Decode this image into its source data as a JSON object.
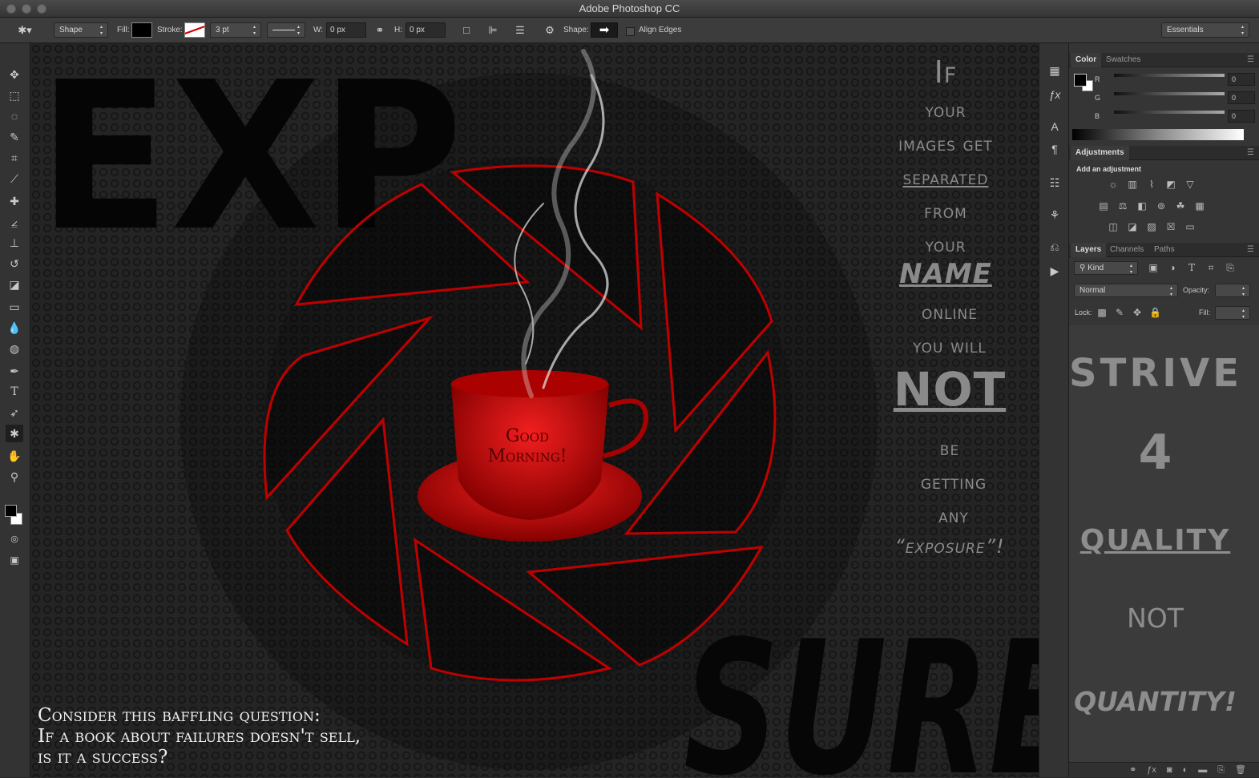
{
  "app": {
    "title": "Adobe Photoshop CC"
  },
  "options_bar": {
    "tool_mode": "Shape",
    "fill_label": "Fill:",
    "stroke_label": "Stroke:",
    "stroke_width": "3 pt",
    "w_label": "W:",
    "w_value": "0 px",
    "h_label": "H:",
    "h_value": "0 px",
    "shape_label": "Shape:",
    "align_edges": "Align Edges",
    "workspace": "Essentials"
  },
  "tools": [
    "move-tool",
    "marquee-tool",
    "lasso-tool",
    "quick-select-tool",
    "crop-tool",
    "eyedropper-tool",
    "healing-tool",
    "brush-tool",
    "stamp-tool",
    "history-brush-tool",
    "eraser-tool",
    "gradient-tool",
    "blur-tool",
    "dodge-tool",
    "pen-tool",
    "type-tool",
    "path-select-tool",
    "custom-shape-tool",
    "hand-tool",
    "zoom-tool"
  ],
  "canvas": {
    "headline_top": "EXP",
    "headline_bottom": "SURE!",
    "cup_text_line1": "Good",
    "cup_text_line2": "Morning!",
    "right_text": [
      "If",
      "your",
      "images get",
      "separated",
      "from",
      "your",
      "NAME",
      "online",
      "you will",
      "NOT",
      "be",
      "getting",
      "any",
      "“exposure”!"
    ],
    "bottom_text": [
      "Consider this baffling question:",
      "If a book about failures doesn't sell,",
      "is it a success?"
    ],
    "accent_color": "#d00000"
  },
  "color_panel": {
    "tabs": [
      "Color",
      "Swatches"
    ],
    "channels": [
      {
        "name": "R",
        "value": "0"
      },
      {
        "name": "G",
        "value": "0"
      },
      {
        "name": "B",
        "value": "0"
      }
    ]
  },
  "adjustments_panel": {
    "tab": "Adjustments",
    "subtitle": "Add an adjustment"
  },
  "layers_panel": {
    "tabs": [
      "Layers",
      "Channels",
      "Paths"
    ],
    "kind_filter": "Kind",
    "blend_mode": "Normal",
    "opacity_label": "Opacity:",
    "lock_label": "Lock:",
    "fill_label": "Fill:",
    "thumbnail_text": [
      "STRIVE",
      "4",
      "QUALITY",
      "NOT",
      "QUANTITY!"
    ]
  }
}
